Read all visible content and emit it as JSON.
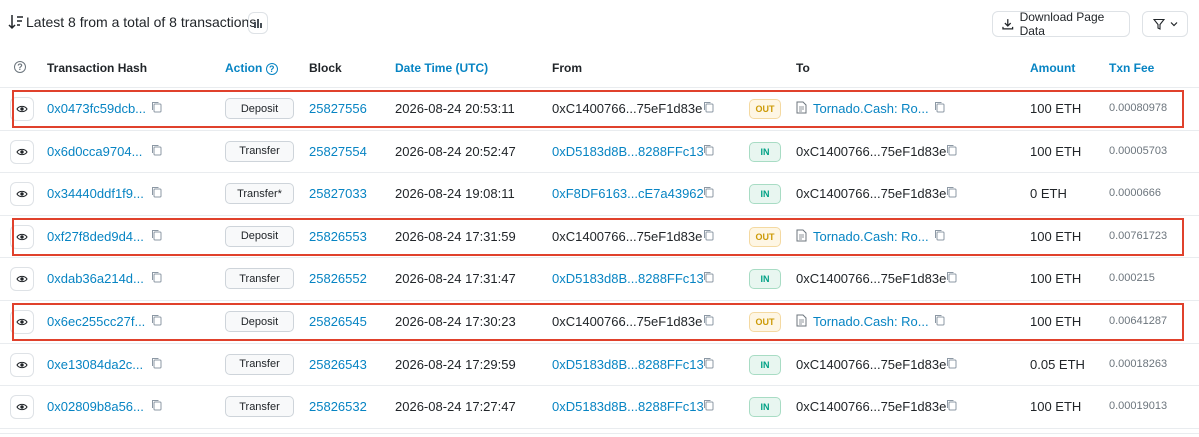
{
  "summary_text": "Latest 8 from a total of 8 transactions",
  "download_label": "Download Page Data",
  "icons": [
    "sort-icon",
    "bar-chart-icon",
    "download-icon",
    "filter-icon",
    "chevron-down-icon",
    "help-icon",
    "eye-icon",
    "copy-icon",
    "document-icon"
  ],
  "colors": {
    "link": "#0784c3",
    "highlight": "#e0412c",
    "out_badge": "#cc9a06",
    "in_badge": "#00a186"
  },
  "headers": {
    "hash": "Transaction Hash",
    "action": "Action",
    "block": "Block",
    "datetime": "Date Time (UTC)",
    "from": "From",
    "to": "To",
    "amount": "Amount",
    "fee": "Txn Fee"
  },
  "rows": [
    {
      "hash": "0x0473fc59dcb...",
      "action": "Deposit",
      "block": "25827556",
      "datetime": "2026-08-24 20:53:11",
      "from": "0xC1400766...75eF1d83e",
      "from_link": false,
      "direction": "OUT",
      "to": "Tornado.Cash: Ro...",
      "to_contract": true,
      "amount": "100 ETH",
      "fee": "0.00080978",
      "highlighted": true
    },
    {
      "hash": "0x6d0cca9704...",
      "action": "Transfer",
      "block": "25827554",
      "datetime": "2026-08-24 20:52:47",
      "from": "0xD5183d8B...8288FFc13",
      "from_link": true,
      "direction": "IN",
      "to": "0xC1400766...75eF1d83e",
      "to_contract": false,
      "amount": "100 ETH",
      "fee": "0.00005703",
      "highlighted": false
    },
    {
      "hash": "0x34440ddf1f9...",
      "action": "Transfer*",
      "block": "25827033",
      "datetime": "2026-08-24 19:08:11",
      "from": "0xF8DF6163...cE7a43962",
      "from_link": true,
      "direction": "IN",
      "to": "0xC1400766...75eF1d83e",
      "to_contract": false,
      "amount": "0 ETH",
      "fee": "0.0000666",
      "highlighted": false
    },
    {
      "hash": "0xf27f8ded9d4...",
      "action": "Deposit",
      "block": "25826553",
      "datetime": "2026-08-24 17:31:59",
      "from": "0xC1400766...75eF1d83e",
      "from_link": false,
      "direction": "OUT",
      "to": "Tornado.Cash: Ro...",
      "to_contract": true,
      "amount": "100 ETH",
      "fee": "0.00761723",
      "highlighted": true
    },
    {
      "hash": "0xdab36a214d...",
      "action": "Transfer",
      "block": "25826552",
      "datetime": "2026-08-24 17:31:47",
      "from": "0xD5183d8B...8288FFc13",
      "from_link": true,
      "direction": "IN",
      "to": "0xC1400766...75eF1d83e",
      "to_contract": false,
      "amount": "100 ETH",
      "fee": "0.000215",
      "highlighted": false
    },
    {
      "hash": "0x6ec255cc27f...",
      "action": "Deposit",
      "block": "25826545",
      "datetime": "2026-08-24 17:30:23",
      "from": "0xC1400766...75eF1d83e",
      "from_link": false,
      "direction": "OUT",
      "to": "Tornado.Cash: Ro...",
      "to_contract": true,
      "amount": "100 ETH",
      "fee": "0.00641287",
      "highlighted": true
    },
    {
      "hash": "0xe13084da2c...",
      "action": "Transfer",
      "block": "25826543",
      "datetime": "2026-08-24 17:29:59",
      "from": "0xD5183d8B...8288FFc13",
      "from_link": true,
      "direction": "IN",
      "to": "0xC1400766...75eF1d83e",
      "to_contract": false,
      "amount": "0.05 ETH",
      "fee": "0.00018263",
      "highlighted": false
    },
    {
      "hash": "0x02809b8a56...",
      "action": "Transfer",
      "block": "25826532",
      "datetime": "2026-08-24 17:27:47",
      "from": "0xD5183d8B...8288FFc13",
      "from_link": true,
      "direction": "IN",
      "to": "0xC1400766...75eF1d83e",
      "to_contract": false,
      "amount": "100 ETH",
      "fee": "0.00019013",
      "highlighted": false
    }
  ]
}
